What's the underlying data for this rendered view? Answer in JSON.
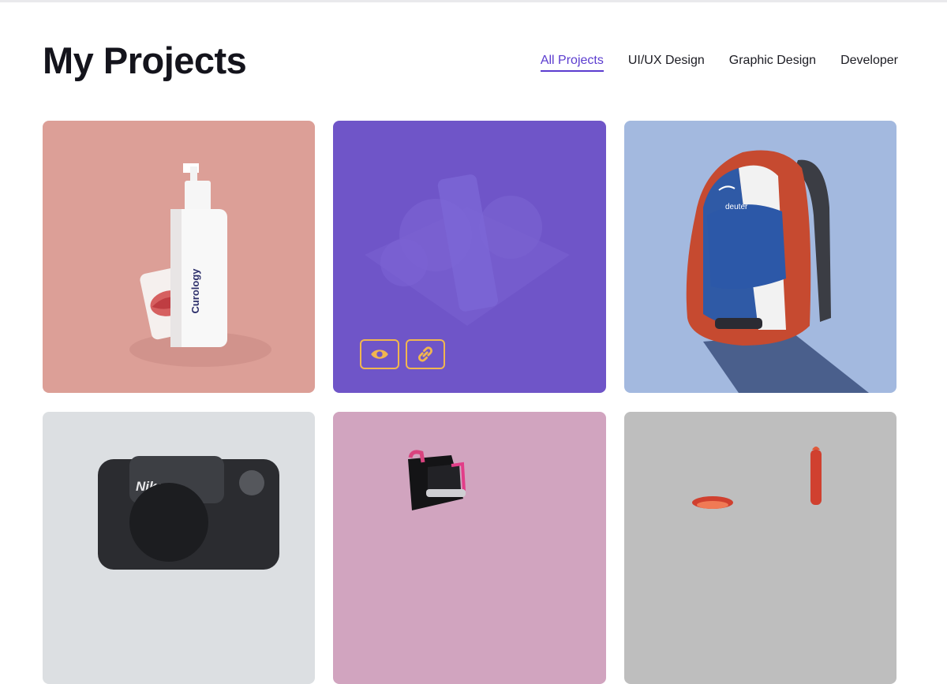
{
  "header": {
    "title": "My Projects"
  },
  "filters": [
    {
      "label": "All Projects",
      "active": true
    },
    {
      "label": "UI/UX Design",
      "active": false
    },
    {
      "label": "Graphic Design",
      "active": false
    },
    {
      "label": "Developer",
      "active": false
    }
  ],
  "projects": [
    {
      "subject": "skincare bottle and lip print",
      "brand_text": "Curology",
      "background": "#dc9f97"
    },
    {
      "subject": "product mockup with hover overlay",
      "background": "#6f55c8",
      "actions": [
        {
          "icon": "eye-icon"
        },
        {
          "icon": "link-icon"
        }
      ]
    },
    {
      "subject": "backpack",
      "brand_text": "deuter",
      "background": "#a3b9df"
    },
    {
      "subject": "camera",
      "brand_text": "Nikon",
      "background": "#dcdfe2"
    },
    {
      "subject": "skate boot",
      "background": "#d1a4bf"
    },
    {
      "subject": "red object on grey",
      "background": "#bebebe"
    }
  ],
  "colors": {
    "accent": "#5b3ccf",
    "overlay_icon": "#f1b64f",
    "title": "#14141c"
  }
}
